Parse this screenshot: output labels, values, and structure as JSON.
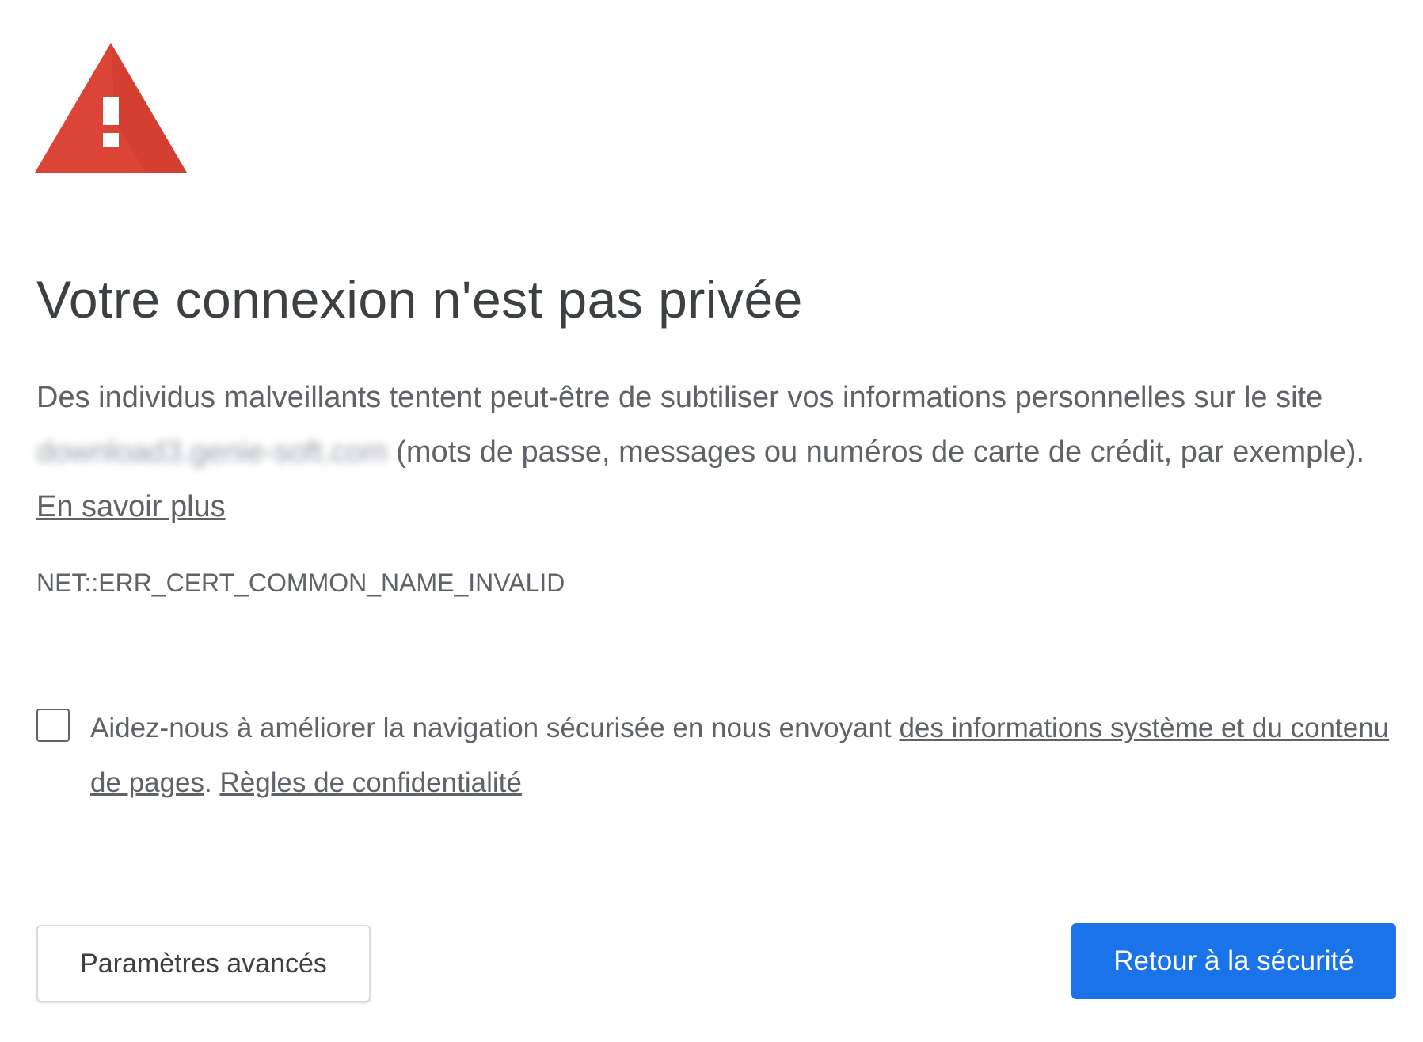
{
  "icon": {
    "name": "warning-triangle-icon",
    "color": "#db4437",
    "glyph": "!"
  },
  "title": "Votre connexion n'est pas privée",
  "description": {
    "part1": "Des individus malveillants tentent peut-être de subtiliser vos informations personnelles sur le site ",
    "site": "download3.genie-soft.com",
    "part2": " (mots de passe, messages ou numéros de carte de crédit, par exemple). ",
    "learn_more": "En savoir plus"
  },
  "error_code": "NET::ERR_CERT_COMMON_NAME_INVALID",
  "optin": {
    "checked": false,
    "text": "Aidez-nous à améliorer la navigation sécurisée en nous envoyant ",
    "link1": "des informations système et du contenu de pages",
    "separator": ". ",
    "link2": "Règles de confidentialité"
  },
  "buttons": {
    "advanced": "Paramètres avancés",
    "back": "Retour à la sécurité"
  },
  "colors": {
    "primary": "#1a73e8",
    "warning": "#db4437",
    "text": "#5f6368",
    "heading": "#3c4043"
  }
}
